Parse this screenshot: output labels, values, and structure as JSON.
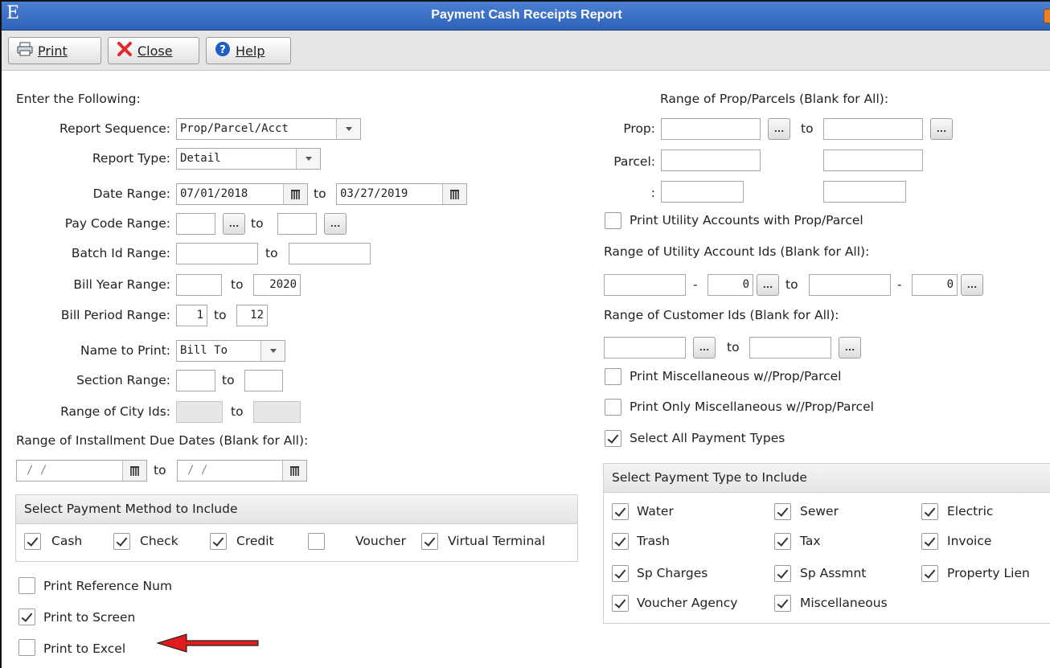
{
  "window": {
    "logo": "E",
    "title": "Payment Cash Receipts Report"
  },
  "toolbar": {
    "print_label": "Print",
    "close_label": "Close",
    "help_label": "Help"
  },
  "left": {
    "intro": "Enter the Following:",
    "report_sequence": {
      "label": "Report Sequence:",
      "value": "Prop/Parcel/Acct"
    },
    "report_type": {
      "label": "Report Type:",
      "value": "Detail"
    },
    "date_range": {
      "label": "Date Range:",
      "from": "07/01/2018",
      "to_label": "to",
      "to": "03/27/2019"
    },
    "pay_code_range": {
      "label": "Pay Code Range:",
      "from": "",
      "to_label": "to",
      "to": ""
    },
    "batch_id_range": {
      "label": "Batch Id Range:",
      "from": "",
      "to_label": "to",
      "to": ""
    },
    "bill_year_range": {
      "label": "Bill Year Range:",
      "from": "",
      "to_label": "to",
      "to": "2020"
    },
    "bill_period_range": {
      "label": "Bill Period Range:",
      "from": "1",
      "to_label": "to",
      "to": "12"
    },
    "name_to_print": {
      "label": "Name to Print:",
      "value": "Bill To"
    },
    "section_range": {
      "label": "Section Range:",
      "from": "",
      "to_label": "to",
      "to": ""
    },
    "city_ids_range": {
      "label": "Range of City Ids:",
      "from": "",
      "to_label": "to",
      "to": ""
    },
    "installment": {
      "label": "Range of Installment Due Dates (Blank for All):",
      "from": " /  /",
      "to_label": "to",
      "to": " /  /"
    },
    "payment_method": {
      "heading": "Select Payment Method to Include",
      "options": [
        {
          "label": "Cash",
          "checked": true
        },
        {
          "label": "Check",
          "checked": true
        },
        {
          "label": "Credit",
          "checked": true
        },
        {
          "label": "Voucher",
          "checked": false
        },
        {
          "label": "Virtual Terminal",
          "checked": true
        }
      ]
    },
    "print_reference_num": {
      "label": "Print Reference Num",
      "checked": false
    },
    "print_to_screen": {
      "label": "Print to Screen",
      "checked": true
    },
    "print_to_excel": {
      "label": "Print to Excel",
      "checked": false
    }
  },
  "right": {
    "prop_parcel_heading": "Range of Prop/Parcels (Blank for All):",
    "prop_label": "Prop:",
    "to_label": "to",
    "parcel_label": "Parcel:",
    "colon_label": ":",
    "print_utility_accounts": {
      "label": "Print Utility Accounts with Prop/Parcel",
      "checked": false
    },
    "utility_ids_heading": "Range of Utility Account Ids (Blank for All):",
    "utility_from_sub": "0",
    "utility_to_sub": "0",
    "dash": "-",
    "customer_ids_heading": "Range of Customer Ids (Blank for All):",
    "print_misc_with_prop": {
      "label": "Print Miscellaneous w//Prop/Parcel",
      "checked": false
    },
    "print_only_misc": {
      "label": "Print Only Miscellaneous w//Prop/Parcel",
      "checked": false
    },
    "select_all_payment_types": {
      "label": "Select All Payment Types",
      "checked": true
    },
    "payment_types": {
      "heading": "Select Payment Type to Include",
      "options": [
        {
          "label": "Water",
          "checked": true
        },
        {
          "label": "Sewer",
          "checked": true
        },
        {
          "label": "Electric",
          "checked": true
        },
        {
          "label": "Trash",
          "checked": true
        },
        {
          "label": "Tax",
          "checked": true
        },
        {
          "label": "Invoice",
          "checked": true
        },
        {
          "label": "Sp Charges",
          "checked": true
        },
        {
          "label": "Sp Assmnt",
          "checked": true
        },
        {
          "label": "Property Lien",
          "checked": true
        },
        {
          "label": "Voucher Agency",
          "checked": true
        },
        {
          "label": "Miscellaneous",
          "checked": true
        }
      ]
    }
  },
  "ellipsis": "...",
  "colors": {
    "titlebar": "#2f63b8",
    "arrow": "#e01b1b",
    "minimize": "#e9822a"
  }
}
